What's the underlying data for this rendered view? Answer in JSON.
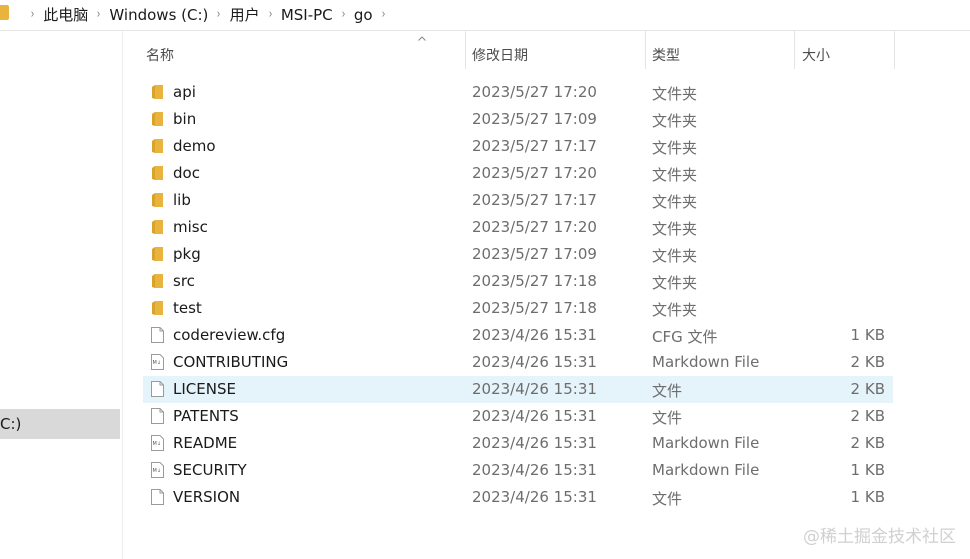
{
  "breadcrumb": {
    "items": [
      "此电脑",
      "Windows (C:)",
      "用户",
      "MSI-PC",
      "go"
    ]
  },
  "nav": {
    "selected_label": "C:)"
  },
  "columns": {
    "name": "名称",
    "date": "修改日期",
    "type": "类型",
    "size": "大小"
  },
  "files": [
    {
      "name": "api",
      "date": "2023/5/27 17:20",
      "type": "文件夹",
      "size": "",
      "icon": "folder-icon"
    },
    {
      "name": "bin",
      "date": "2023/5/27 17:09",
      "type": "文件夹",
      "size": "",
      "icon": "folder-icon"
    },
    {
      "name": "demo",
      "date": "2023/5/27 17:17",
      "type": "文件夹",
      "size": "",
      "icon": "folder-icon"
    },
    {
      "name": "doc",
      "date": "2023/5/27 17:20",
      "type": "文件夹",
      "size": "",
      "icon": "folder-icon"
    },
    {
      "name": "lib",
      "date": "2023/5/27 17:17",
      "type": "文件夹",
      "size": "",
      "icon": "folder-icon"
    },
    {
      "name": "misc",
      "date": "2023/5/27 17:20",
      "type": "文件夹",
      "size": "",
      "icon": "folder-icon"
    },
    {
      "name": "pkg",
      "date": "2023/5/27 17:09",
      "type": "文件夹",
      "size": "",
      "icon": "folder-icon"
    },
    {
      "name": "src",
      "date": "2023/5/27 17:18",
      "type": "文件夹",
      "size": "",
      "icon": "folder-icon"
    },
    {
      "name": "test",
      "date": "2023/5/27 17:18",
      "type": "文件夹",
      "size": "",
      "icon": "folder-icon"
    },
    {
      "name": "codereview.cfg",
      "date": "2023/4/26 15:31",
      "type": "CFG 文件",
      "size": "1 KB",
      "icon": "file-icon"
    },
    {
      "name": "CONTRIBUTING",
      "date": "2023/4/26 15:31",
      "type": "Markdown File",
      "size": "2 KB",
      "icon": "markdown-file-icon"
    },
    {
      "name": "LICENSE",
      "date": "2023/4/26 15:31",
      "type": "文件",
      "size": "2 KB",
      "icon": "file-icon",
      "selected": true
    },
    {
      "name": "PATENTS",
      "date": "2023/4/26 15:31",
      "type": "文件",
      "size": "2 KB",
      "icon": "file-icon"
    },
    {
      "name": "README",
      "date": "2023/4/26 15:31",
      "type": "Markdown File",
      "size": "2 KB",
      "icon": "markdown-file-icon"
    },
    {
      "name": "SECURITY",
      "date": "2023/4/26 15:31",
      "type": "Markdown File",
      "size": "1 KB",
      "icon": "markdown-file-icon"
    },
    {
      "name": "VERSION",
      "date": "2023/4/26 15:31",
      "type": "文件",
      "size": "1 KB",
      "icon": "file-icon"
    }
  ],
  "watermark": "@稀土掘金技术社区",
  "colors": {
    "folder": "#e8b43d",
    "selected_row": "#e5f3fb",
    "nav_selected": "#d9d9d9"
  }
}
